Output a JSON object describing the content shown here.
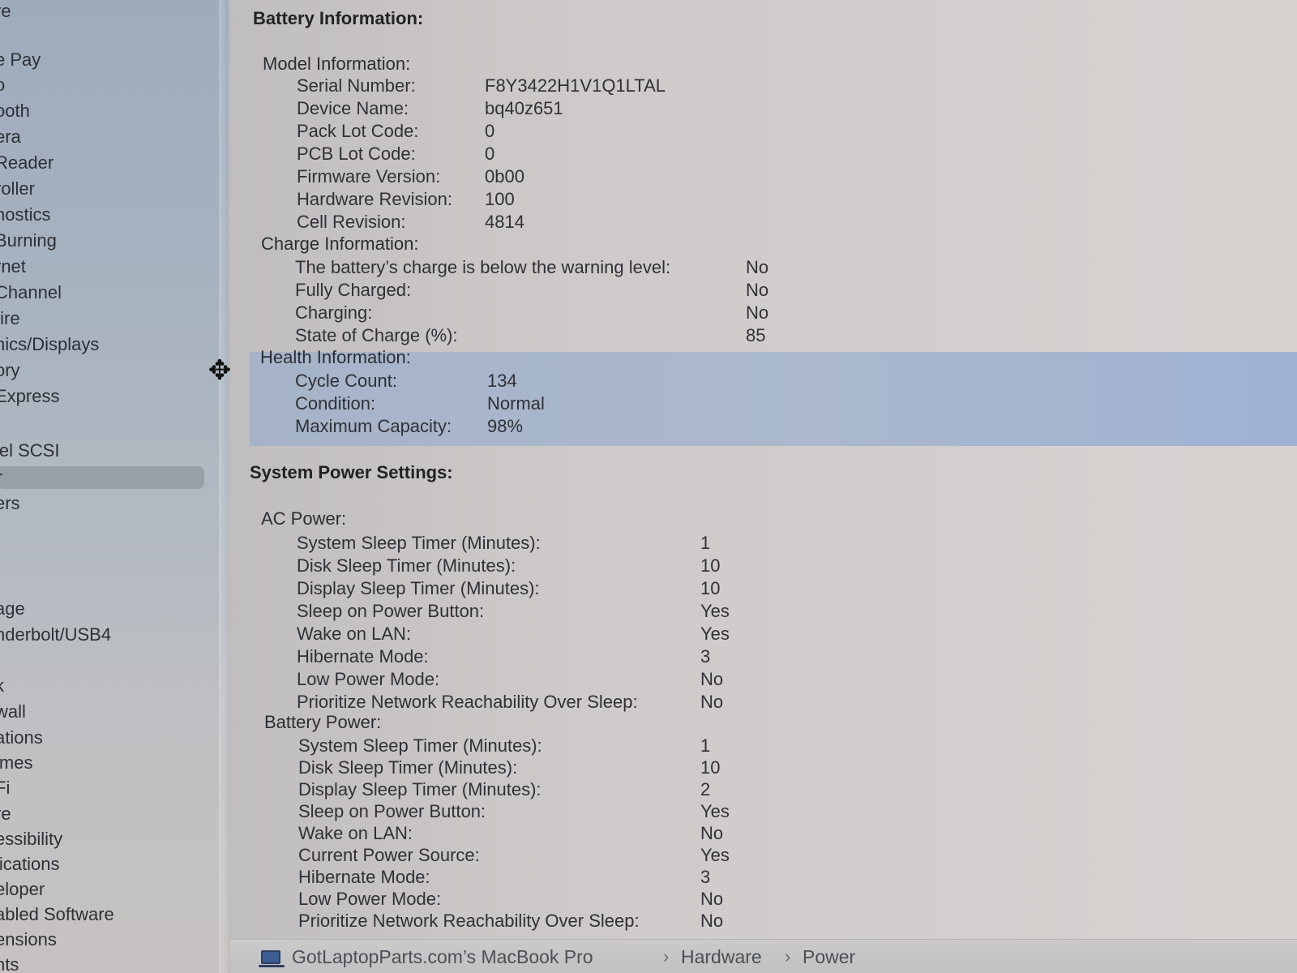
{
  "sidebar": {
    "items": [
      "re",
      "e Pay",
      "o",
      "ooth",
      "era",
      " Reader",
      "roller",
      "nostics",
      "Burning",
      "rnet",
      " Channel",
      "/ire",
      "hics/Displays",
      "ory",
      "Express",
      "lel SCSI",
      "r",
      "ers",
      "\\",
      "age",
      "nderbolt/USB4",
      "k",
      "wall",
      "ations",
      "imes",
      "Fi",
      "re",
      "essibility",
      "lications",
      "eloper",
      "abled Software",
      "ensions",
      "nts"
    ]
  },
  "battery": {
    "title": "Battery Information:",
    "model": {
      "title": "Model Information:",
      "rows": [
        {
          "label": "Serial Number:",
          "value": "F8Y3422H1V1Q1LTAL"
        },
        {
          "label": "Device Name:",
          "value": "bq40z651"
        },
        {
          "label": "Pack Lot Code:",
          "value": "0"
        },
        {
          "label": "PCB Lot Code:",
          "value": "0"
        },
        {
          "label": "Firmware Version:",
          "value": "0b00"
        },
        {
          "label": "Hardware Revision:",
          "value": "100"
        },
        {
          "label": "Cell Revision:",
          "value": "4814"
        }
      ]
    },
    "charge": {
      "title": "Charge Information:",
      "rows": [
        {
          "label": "The battery’s charge is below the warning level:",
          "value": "No"
        },
        {
          "label": "Fully Charged:",
          "value": "No"
        },
        {
          "label": "Charging:",
          "value": "No"
        },
        {
          "label": "State of Charge (%):",
          "value": "85"
        }
      ]
    },
    "health": {
      "title": "Health Information:",
      "rows": [
        {
          "label": "Cycle Count:",
          "value": "134"
        },
        {
          "label": "Condition:",
          "value": "Normal"
        },
        {
          "label": "Maximum Capacity:",
          "value": "98%"
        }
      ]
    }
  },
  "power": {
    "title": "System Power Settings:",
    "ac": {
      "title": "AC Power:",
      "rows": [
        {
          "label": "System Sleep Timer (Minutes):",
          "value": "1"
        },
        {
          "label": "Disk Sleep Timer (Minutes):",
          "value": "10"
        },
        {
          "label": "Display Sleep Timer (Minutes):",
          "value": "10"
        },
        {
          "label": "Sleep on Power Button:",
          "value": "Yes"
        },
        {
          "label": "Wake on LAN:",
          "value": "Yes"
        },
        {
          "label": "Hibernate Mode:",
          "value": "3"
        },
        {
          "label": "Low Power Mode:",
          "value": "No"
        },
        {
          "label": "Prioritize Network Reachability Over Sleep:",
          "value": "No"
        }
      ]
    },
    "battery": {
      "title": "Battery Power:",
      "rows": [
        {
          "label": "System Sleep Timer (Minutes):",
          "value": "1"
        },
        {
          "label": "Disk Sleep Timer (Minutes):",
          "value": "10"
        },
        {
          "label": "Display Sleep Timer (Minutes):",
          "value": "2"
        },
        {
          "label": "Sleep on Power Button:",
          "value": "Yes"
        },
        {
          "label": "Wake on LAN:",
          "value": "No"
        },
        {
          "label": "Current Power Source:",
          "value": "Yes"
        },
        {
          "label": "Hibernate Mode:",
          "value": "3"
        },
        {
          "label": "Low Power Mode:",
          "value": "No"
        },
        {
          "label": "Prioritize Network Reachability Over Sleep:",
          "value": "No"
        }
      ]
    }
  },
  "path": {
    "root": "GotLaptopParts.com’s MacBook Pro",
    "section": "Hardware",
    "current": "Power",
    "separator": "›"
  },
  "icons": {
    "cursor": "resize-horizontal-cursor-icon",
    "computer": "laptop-icon"
  }
}
